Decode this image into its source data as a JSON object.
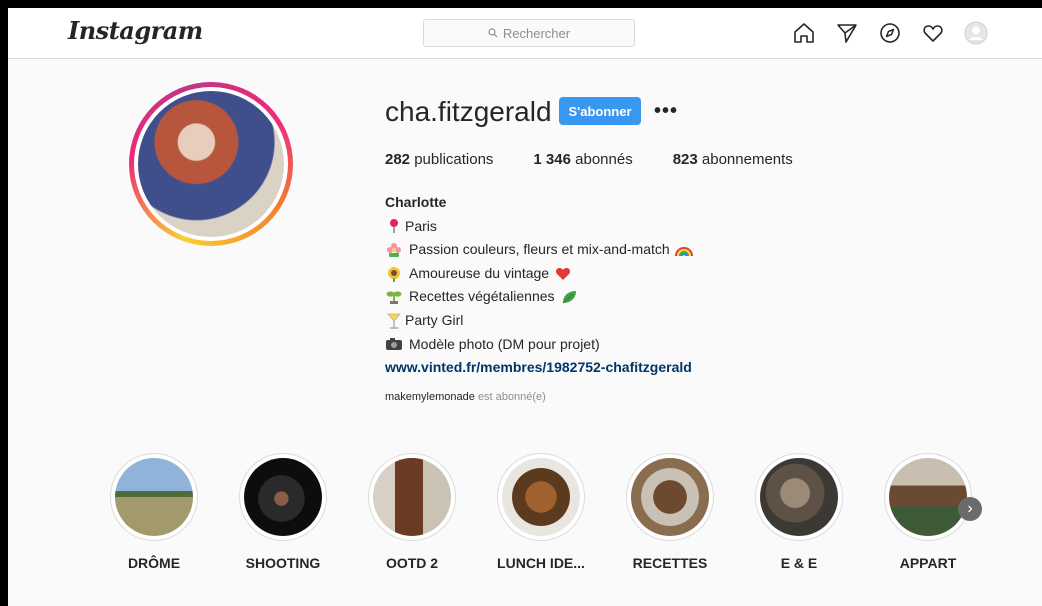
{
  "header": {
    "logo": "Instagram",
    "search_placeholder": "Rechercher",
    "nav_icons": [
      "home-icon",
      "direct-icon",
      "explore-icon",
      "activity-icon",
      "profile-icon"
    ]
  },
  "profile": {
    "username": "cha.fitzgerald",
    "follow_label": "S'abonner",
    "more_label": "•••",
    "stats": [
      {
        "count": "282",
        "label": "publications"
      },
      {
        "count": "1 346",
        "label": "abonnés"
      },
      {
        "count": "823",
        "label": "abonnements"
      }
    ],
    "bio": {
      "name": "Charlotte",
      "lines": [
        "Paris",
        "Passion couleurs, fleurs et mix-and-match",
        "Amoureuse du vintage",
        "Recettes végétaliennes",
        "Party Girl",
        "Modèle photo (DM pour projet)"
      ],
      "link": "www.vinted.fr/membres/1982752-chafitzgerald"
    },
    "followed_by_user": "makemylemonade",
    "followed_by_text": "est abonné(e)"
  },
  "highlights": [
    {
      "label": "DRÔME"
    },
    {
      "label": "SHOOTING"
    },
    {
      "label": "OOTD 2"
    },
    {
      "label": "LUNCH IDE..."
    },
    {
      "label": "RECETTES"
    },
    {
      "label": "E & E"
    },
    {
      "label": "APPART"
    }
  ],
  "colors": {
    "accent": "#3897f0",
    "link": "#003569",
    "muted": "#8e8e8e",
    "background": "#fafafa"
  }
}
